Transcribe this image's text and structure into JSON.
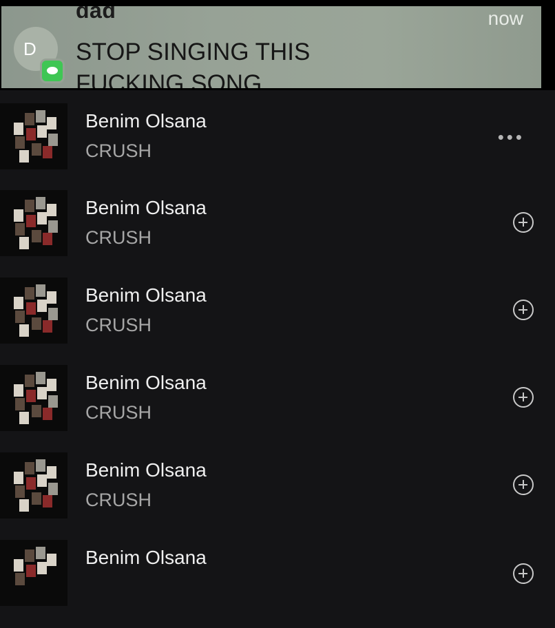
{
  "notification": {
    "sender": "dad",
    "avatar_letter": "D",
    "app_icon": "message-bubble-icon",
    "time": "now",
    "message_line1": "STOP SINGING THIS",
    "message_line2": "FUCKING SONG"
  },
  "tracks": [
    {
      "title": "Benim Olsana",
      "artist": "CRUSH",
      "action_icon": "more-options-icon"
    },
    {
      "title": "Benim Olsana",
      "artist": "CRUSH",
      "action_icon": "add-circle-icon"
    },
    {
      "title": "Benim Olsana",
      "artist": "CRUSH",
      "action_icon": "add-circle-icon"
    },
    {
      "title": "Benim Olsana",
      "artist": "CRUSH",
      "action_icon": "add-circle-icon"
    },
    {
      "title": "Benim Olsana",
      "artist": "CRUSH",
      "action_icon": "add-circle-icon"
    },
    {
      "title": "Benim Olsana",
      "artist": "",
      "action_icon": "add-circle-icon"
    }
  ],
  "colors": {
    "background": "#141416",
    "banner": "#97a296",
    "title_text": "#efefef",
    "subtitle_text": "#a7a7a7"
  }
}
